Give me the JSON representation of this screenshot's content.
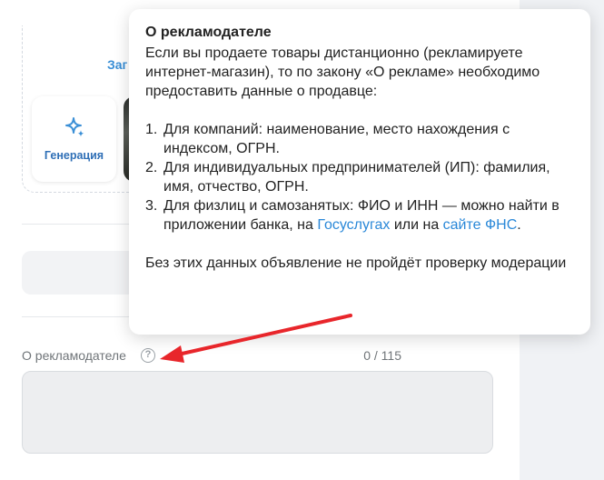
{
  "upload": {
    "link_label": "Заг"
  },
  "generation": {
    "label": "Генерация",
    "icon": "sparkles-icon"
  },
  "advertiser_field": {
    "label": "О рекламодателе",
    "help_icon": "question-circle-icon",
    "help_glyph": "?",
    "counter": "0 / 115",
    "value": ""
  },
  "tooltip": {
    "title": "О рекламодателе",
    "intro": "Если вы продаете товары дистанционно (рекламируете интернет-магазин), то по закону «О рекламе» необходимо предоставить данные о продавце:",
    "items": [
      {
        "num": "1.",
        "text": "Для компаний: наименование, место нахождения с индексом, ОГРН."
      },
      {
        "num": "2.",
        "text": "Для индивидуальных предпринимателей (ИП): фамилия, имя, отчество, ОГРН."
      },
      {
        "num": "3.",
        "text_before": "Для физлиц и самозанятых: ФИО и ИНН — можно найти в приложении банка, на ",
        "link1": "Госуслугах",
        "text_middle": " или на ",
        "link2": "сайте ФНС",
        "text_after": "."
      }
    ],
    "outro": "Без этих данных объявление не пройдёт проверку модерации"
  },
  "colors": {
    "accent": "#2a88d8",
    "arrow": "#e8262b",
    "panel": "#ffffff",
    "background": "#f0f2f5"
  }
}
